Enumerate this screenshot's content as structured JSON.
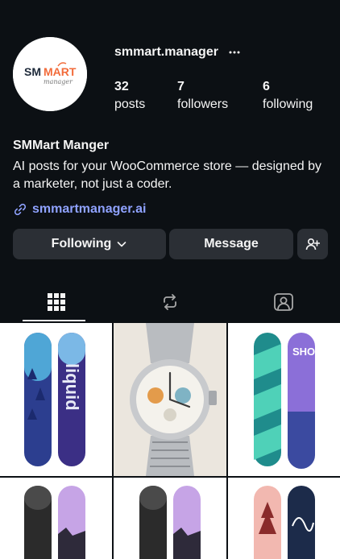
{
  "profile": {
    "username": "smmart.manager",
    "display_name": "SMMart Manger",
    "bio": "AI posts for your WooCommerce store — designed by a marketer, not just a coder.",
    "link": "smmartmanager.ai",
    "avatar_logo": {
      "brand_left": "SM",
      "brand_right": "MART",
      "tagline": "manager"
    }
  },
  "stats": {
    "posts": {
      "count": "32",
      "label": "posts"
    },
    "followers": {
      "count": "7",
      "label": "followers"
    },
    "following": {
      "count": "6",
      "label": "following"
    }
  },
  "actions": {
    "following_label": "Following",
    "message_label": "Message"
  },
  "tabs": [
    {
      "name": "posts",
      "icon": "grid-icon",
      "active": true
    },
    {
      "name": "reposts",
      "icon": "repost-icon",
      "active": false
    },
    {
      "name": "tagged",
      "icon": "tagged-icon",
      "active": false
    }
  ],
  "grid_posts": [
    {
      "subject": "snowboard pair",
      "art_text": "liquid"
    },
    {
      "subject": "chronograph watch"
    },
    {
      "subject": "snowboard pair",
      "art_text": "SHOPIFY"
    },
    {
      "subject": "snowboard pair"
    },
    {
      "subject": "snowboard pair"
    },
    {
      "subject": "snowboard pair"
    }
  ],
  "colors": {
    "background": "#0c1014",
    "button": "#2b2f35",
    "link": "#8fa2ff",
    "brand_orange": "#f26b3a"
  }
}
